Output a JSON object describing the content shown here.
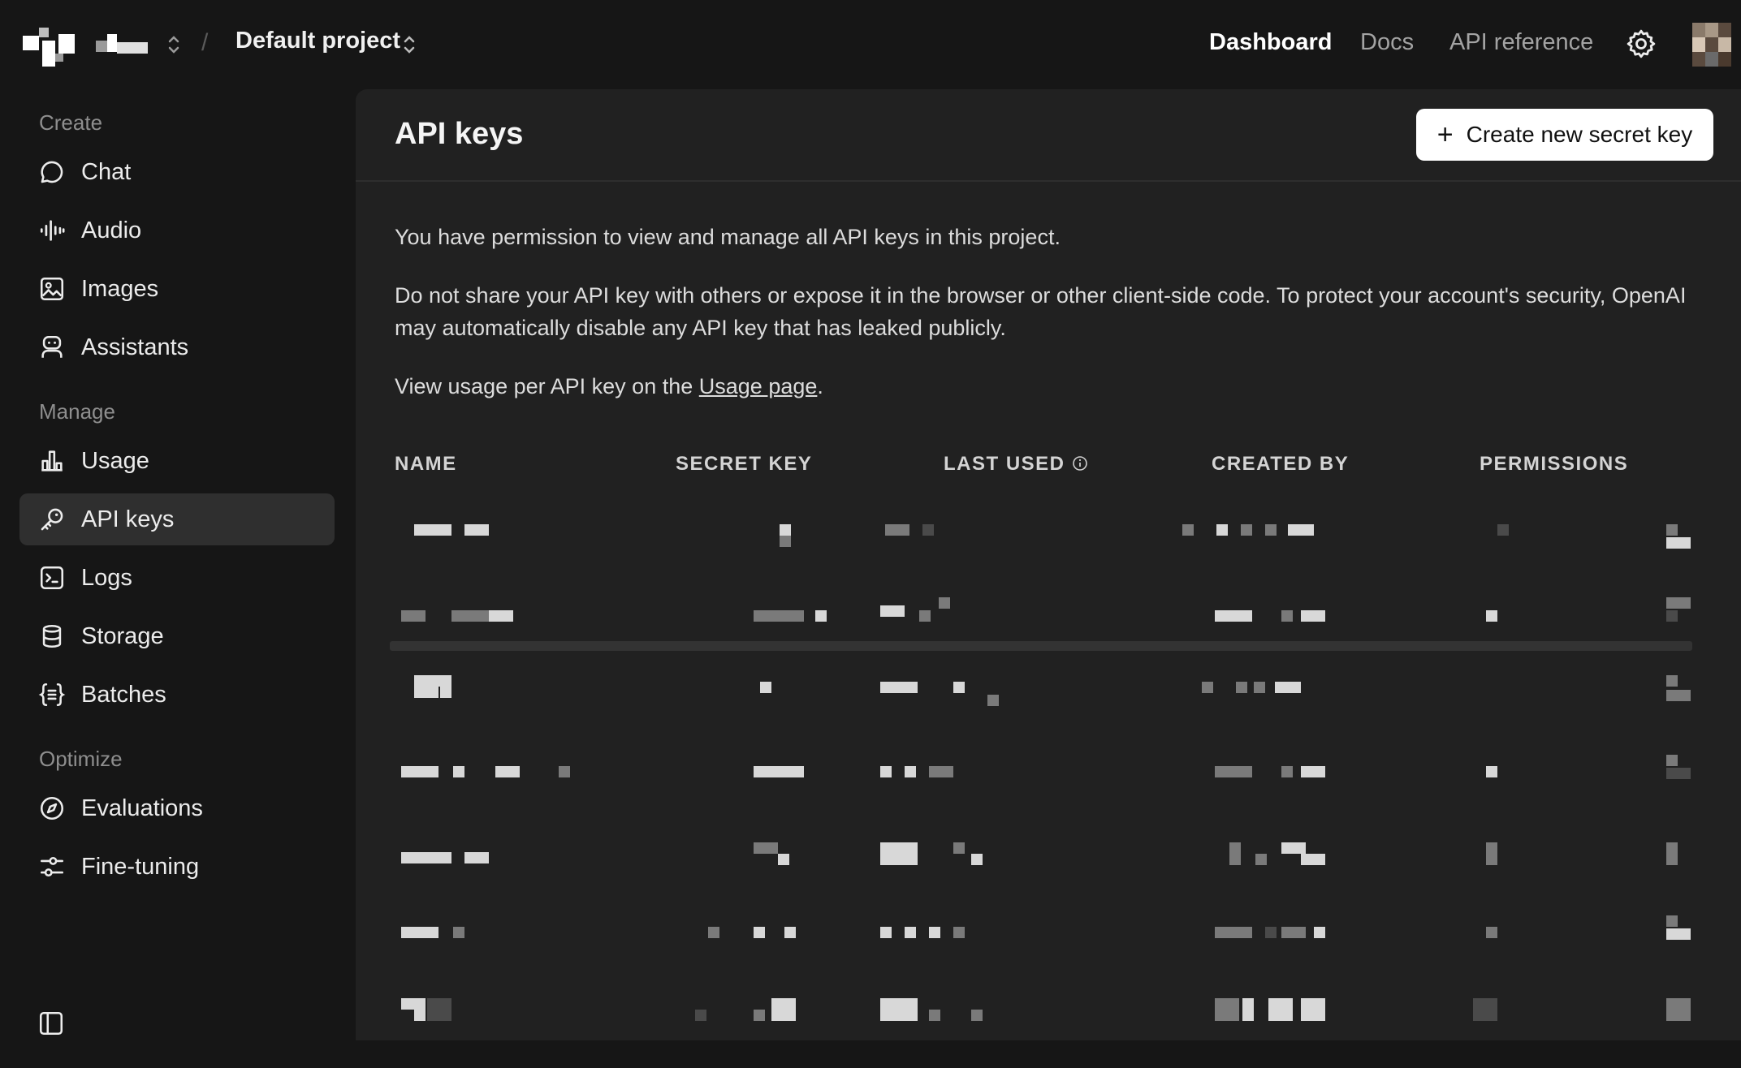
{
  "topbar": {
    "project_name": "Default project",
    "slash": "/",
    "nav": {
      "dashboard": "Dashboard",
      "docs": "Docs",
      "api_reference": "API reference"
    }
  },
  "sidebar": {
    "sections": {
      "create": "Create",
      "manage": "Manage",
      "optimize": "Optimize"
    },
    "items": {
      "chat": "Chat",
      "audio": "Audio",
      "images": "Images",
      "assistants": "Assistants",
      "usage": "Usage",
      "api_keys": "API keys",
      "logs": "Logs",
      "storage": "Storage",
      "batches": "Batches",
      "evaluations": "Evaluations",
      "fine_tuning": "Fine-tuning"
    },
    "active": "api_keys"
  },
  "main": {
    "title": "API keys",
    "create_button": "Create new secret key",
    "p1": "You have permission to view and manage all API keys in this project.",
    "p2": "Do not share your API key with others or expose it in the browser or other client-side code. To protect your account's security, OpenAI may automatically disable any API key that has leaked publicly.",
    "p3_prefix": "View usage per API key on the",
    "p3_link": "Usage page",
    "p3_suffix": ".",
    "columns": {
      "name": "NAME",
      "secret_key": "SECRET KEY",
      "last_used": "LAST USED",
      "created_by": "CREATED BY",
      "permissions": "PERMISSIONS"
    }
  },
  "colors": {
    "page_bg": "#161616",
    "panel_bg": "#212121",
    "active_item": "#2f2f2f",
    "button_bg": "#ffffff"
  }
}
